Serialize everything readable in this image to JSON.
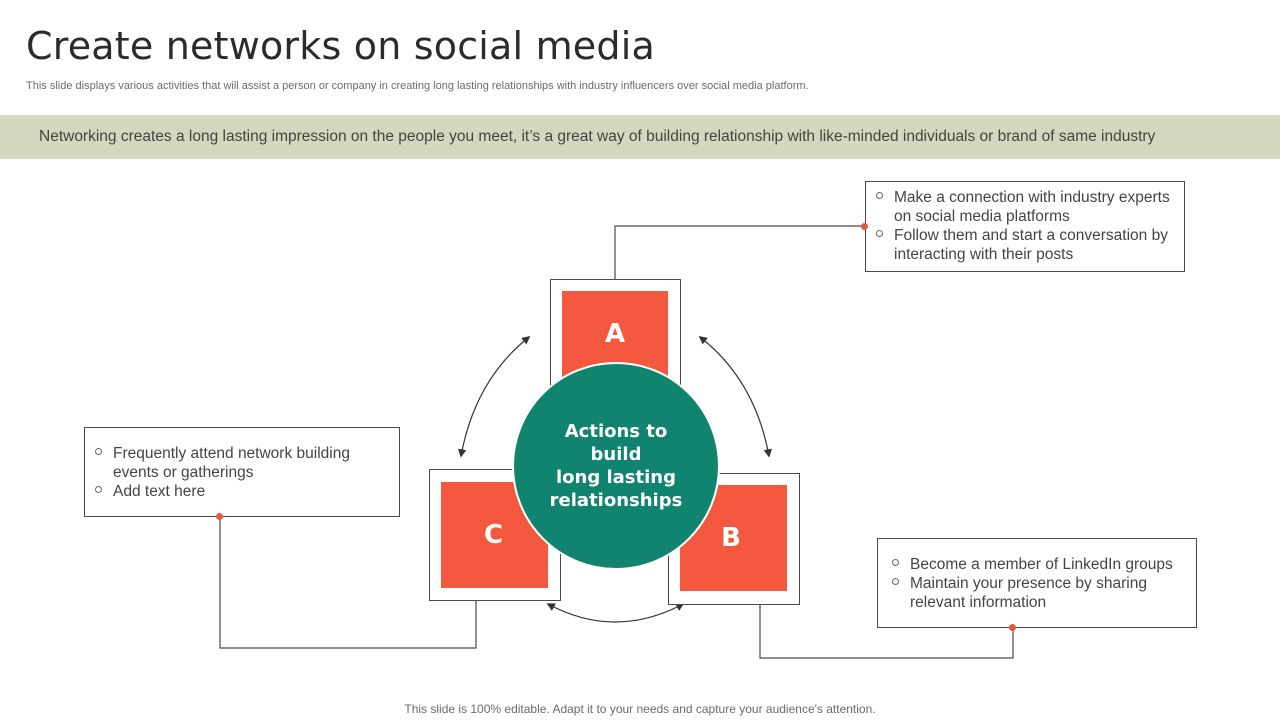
{
  "title": "Create networks on social media",
  "subtitle": "This slide displays various activities that will assist a person or company in creating long lasting relationships with industry influencers over social media platform.",
  "banner": "Networking creates a long lasting impression on the people you meet, it’s a great way of building relationship with like-minded individuals or brand of same industry",
  "center": {
    "lines": [
      "Actions to build",
      "long lasting",
      "relationships"
    ]
  },
  "nodes": {
    "a": {
      "label": "A",
      "bullets": [
        "Make a connection with industry experts on social media platforms",
        "Follow them and start a conversation by interacting with their posts"
      ]
    },
    "b": {
      "label": "B",
      "bullets": [
        "Become a member of LinkedIn groups",
        "Maintain your presence by sharing relevant information"
      ]
    },
    "c": {
      "label": "C",
      "bullets": [
        "Frequently attend network building events or gatherings",
        "Add text here"
      ]
    }
  },
  "colors": {
    "accent": "#f4593f",
    "center": "#118470",
    "banner": "#d2d9bf"
  },
  "footer": "This slide is 100% editable. Adapt it to your needs and capture your audience's attention."
}
